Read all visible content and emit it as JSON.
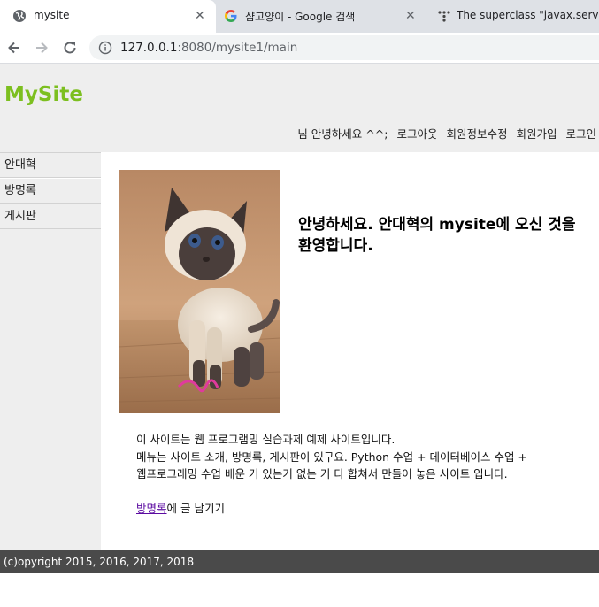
{
  "browser": {
    "tabs": [
      {
        "title": "mysite",
        "icon": "globe-icon",
        "active": true
      },
      {
        "title": "샴고양이 - Google 검색",
        "icon": "google-icon",
        "active": false
      },
      {
        "title": "The superclass \"javax.servlet.h",
        "icon": "stackoverflow-dots-icon",
        "active": false
      }
    ],
    "url_host": "127.0.0.1",
    "url_rest": ":8080/mysite1/main"
  },
  "header": {
    "logo": "MySite",
    "greeting": "님 안녕하세요 ^^;",
    "nav": [
      "로그아웃",
      "회원정보수정",
      "회원가입",
      "로그인"
    ]
  },
  "sidebar": {
    "items": [
      "안대혁",
      "방명록",
      "게시판"
    ]
  },
  "main": {
    "welcome_title": "안녕하세요. 안대혁의 mysite에 오신 것을 환영합니다.",
    "description": [
      "이 사이트는 웹 프로그램밍 실습과제 예제 사이트입니다.",
      "메뉴는 사이트 소개, 방명록, 게시판이 있구요. Python 수업 + 데이터베이스 수업 +",
      "웹프로그래밍 수업 배운 거 있는거 없는 거 다 합쳐서 만들어 놓은 사이트 입니다."
    ],
    "guestbook_link": "방명록",
    "guestbook_suffix": "에 글 남기기"
  },
  "footer": {
    "copyright": "(c)opyright 2015, 2016, 2017, 2018"
  },
  "colors": {
    "logo": "#7cbf1f",
    "footer_bg": "#4a4a4a",
    "sidebar_bg": "#eeeeee",
    "link_visited": "#5b0aa0"
  }
}
